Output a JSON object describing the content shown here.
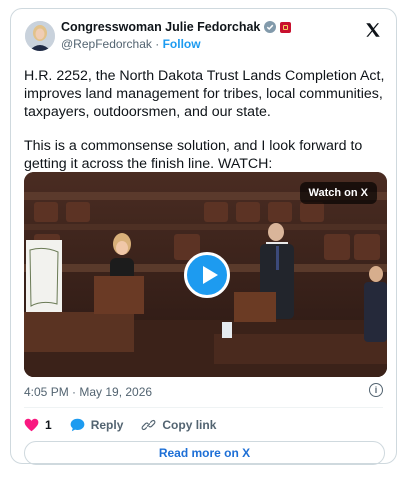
{
  "author": {
    "name": "Congresswoman Julie Fedorchak",
    "handle": "@RepFedorchak",
    "separator": "·",
    "follow_label": "Follow"
  },
  "tweet": {
    "paragraph1": "H.R. 2252, the North Dakota Trust Lands Completion Act, improves land management for tribes, local communities, taxpayers, outdoorsmen, and our state.",
    "paragraph2": "This is a commonsense solution, and I look forward to getting it across the finish line. WATCH:"
  },
  "media": {
    "watch_label": "Watch on X",
    "play_icon": "play-icon"
  },
  "meta": {
    "timestamp": "4:05 PM · May 19, 2026"
  },
  "actions": {
    "like_count": "1",
    "reply_label": "Reply",
    "copy_label": "Copy link"
  },
  "read_more_label": "Read more on X",
  "colors": {
    "accent": "#1d9bf0",
    "like": "#f91880",
    "text_secondary": "#536471",
    "border": "#cfd9de"
  }
}
